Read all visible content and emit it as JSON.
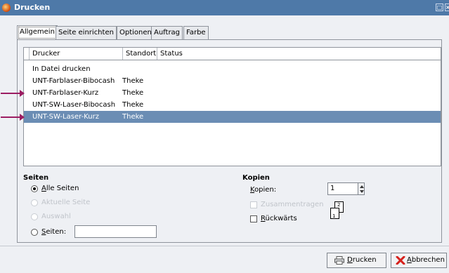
{
  "window": {
    "title": "Drucken",
    "icon": "printer-app-icon",
    "maximize_glyph": "□",
    "close_glyph": "×"
  },
  "tabs": [
    {
      "label": "Allgemein",
      "active": true
    },
    {
      "label": "Seite einrichten",
      "active": false
    },
    {
      "label": "Optionen",
      "active": false
    },
    {
      "label": "Auftrag",
      "active": false
    },
    {
      "label": "Farbe",
      "active": false
    }
  ],
  "printer_list": {
    "columns": [
      "Drucker",
      "Standort",
      "Status"
    ],
    "rows": [
      {
        "name": "In Datei drucken",
        "location": "",
        "status": "",
        "selected": false,
        "marked": false
      },
      {
        "name": "UNT-Farblaser-Bibocash",
        "location": "Theke",
        "status": "",
        "selected": false,
        "marked": false
      },
      {
        "name": "UNT-Farblaser-Kurz",
        "location": "Theke",
        "status": "",
        "selected": false,
        "marked": true
      },
      {
        "name": "UNT-SW-Laser-Bibocash",
        "location": "Theke",
        "status": "",
        "selected": false,
        "marked": false
      },
      {
        "name": "UNT-SW-Laser-Kurz",
        "location": "Theke",
        "status": "",
        "selected": true,
        "marked": true
      }
    ]
  },
  "pages": {
    "title": "Seiten",
    "all_pages_first": "A",
    "all_pages_rest": "lle Seiten",
    "current_page": "Aktuelle Seite",
    "selection": "Auswahl",
    "pages_first": "S",
    "pages_rest": "eiten:",
    "pages_value": ""
  },
  "copies": {
    "title": "Kopien",
    "copies_first": "K",
    "copies_rest": "opien:",
    "copies_value": "1",
    "collate": "Zusammentragen",
    "reverse_first": "R",
    "reverse_rest": "ückwärts",
    "preview_page_1": "1",
    "preview_page_2": "2"
  },
  "buttons": {
    "print_first": "D",
    "print_rest": "rucken",
    "print_icon": "printer-icon",
    "cancel_first": "A",
    "cancel_rest": "bbrechen",
    "cancel_icon": "cancel-icon"
  },
  "colors": {
    "titlebar": "#4e79a8",
    "selection": "#6b8db4",
    "marker_arrow": "#9c1d62"
  }
}
